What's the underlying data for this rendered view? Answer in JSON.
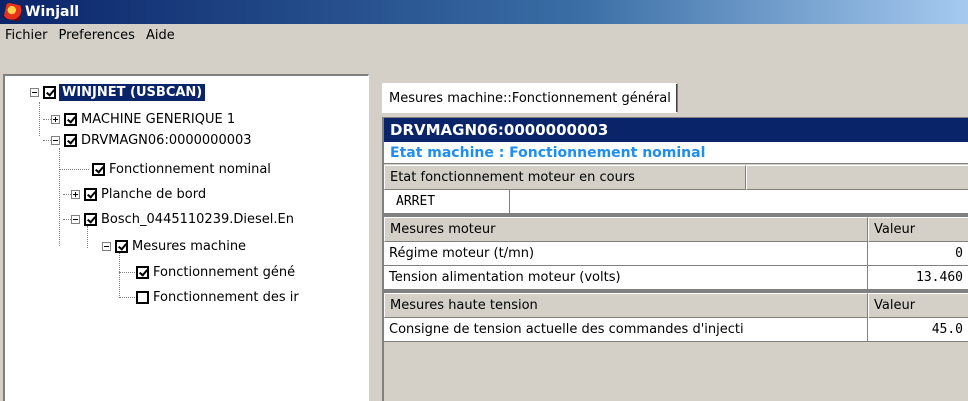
{
  "window": {
    "title": "Winjall"
  },
  "menu": {
    "items": [
      "Fichier",
      "Preferences",
      "Aide"
    ]
  },
  "tree": {
    "root": "WINJNET (USBCAN)",
    "nodes": [
      "MACHINE GENERIQUE 1",
      "DRVMAGN06:0000000003",
      "Fonctionnement nominal",
      "Planche de bord",
      "Bosch_0445110239.Diesel.En",
      "Mesures machine",
      "Fonctionnement géné",
      "Fonctionnement des ir"
    ]
  },
  "tab": {
    "label": "Mesures machine::Fonctionnement général"
  },
  "machine": {
    "id": "DRVMAGN06:0000000003",
    "etat": "Etat machine : Fonctionnement nominal"
  },
  "sections": {
    "etat_moteur": {
      "header": "Etat fonctionnement moteur en cours",
      "value": "ARRET"
    },
    "mesures_moteur": {
      "header": "Mesures moteur",
      "value_header": "Valeur",
      "rows": [
        {
          "label": "Régime moteur (t/mn)",
          "value": "0"
        },
        {
          "label": "Tension alimentation moteur (volts)",
          "value": "13.460"
        }
      ]
    },
    "haute_tension": {
      "header": "Mesures haute tension",
      "value_header": "Valeur",
      "rows": [
        {
          "label": "Consigne de tension actuelle des commandes d'injecti",
          "value": "45.0"
        }
      ]
    }
  }
}
